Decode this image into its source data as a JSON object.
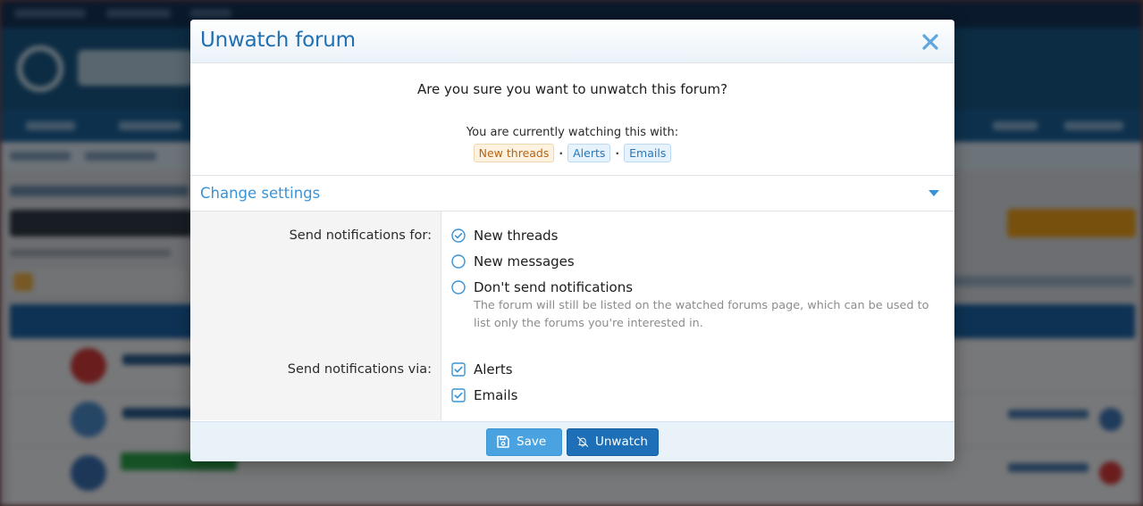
{
  "dialog": {
    "title": "Unwatch forum",
    "close_icon": "close-icon",
    "question": "Are you sure you want to unwatch this forum?",
    "watching_text": "You are currently watching this with:",
    "watching_with": [
      "New threads",
      "Alerts",
      "Emails"
    ],
    "separator": "·"
  },
  "settings": {
    "toggle_label": "Change settings",
    "notify_for_label": "Send notifications for:",
    "notify_for_options": [
      {
        "label": "New threads",
        "selected": true
      },
      {
        "label": "New messages",
        "selected": false
      },
      {
        "label": "Don't send notifications",
        "selected": false
      }
    ],
    "dont_send_hint": "The forum will still be listed on the watched forums page, which can be used to list only the forums you're interested in.",
    "notify_via_label": "Send notifications via:",
    "notify_via_options": [
      {
        "label": "Alerts",
        "checked": true
      },
      {
        "label": "Emails",
        "checked": true
      }
    ]
  },
  "footer": {
    "save_label": "Save",
    "save_icon": "save-icon",
    "unwatch_label": "Unwatch",
    "unwatch_icon": "bell-slash-icon"
  },
  "colors": {
    "accent": "#1f6fb1",
    "link": "#3a93d6",
    "save_button": "#4aa3e0",
    "unwatch_button": "#1d6fb8",
    "pill_orange_text": "#b5661a",
    "pill_blue_text": "#2a77b8"
  }
}
